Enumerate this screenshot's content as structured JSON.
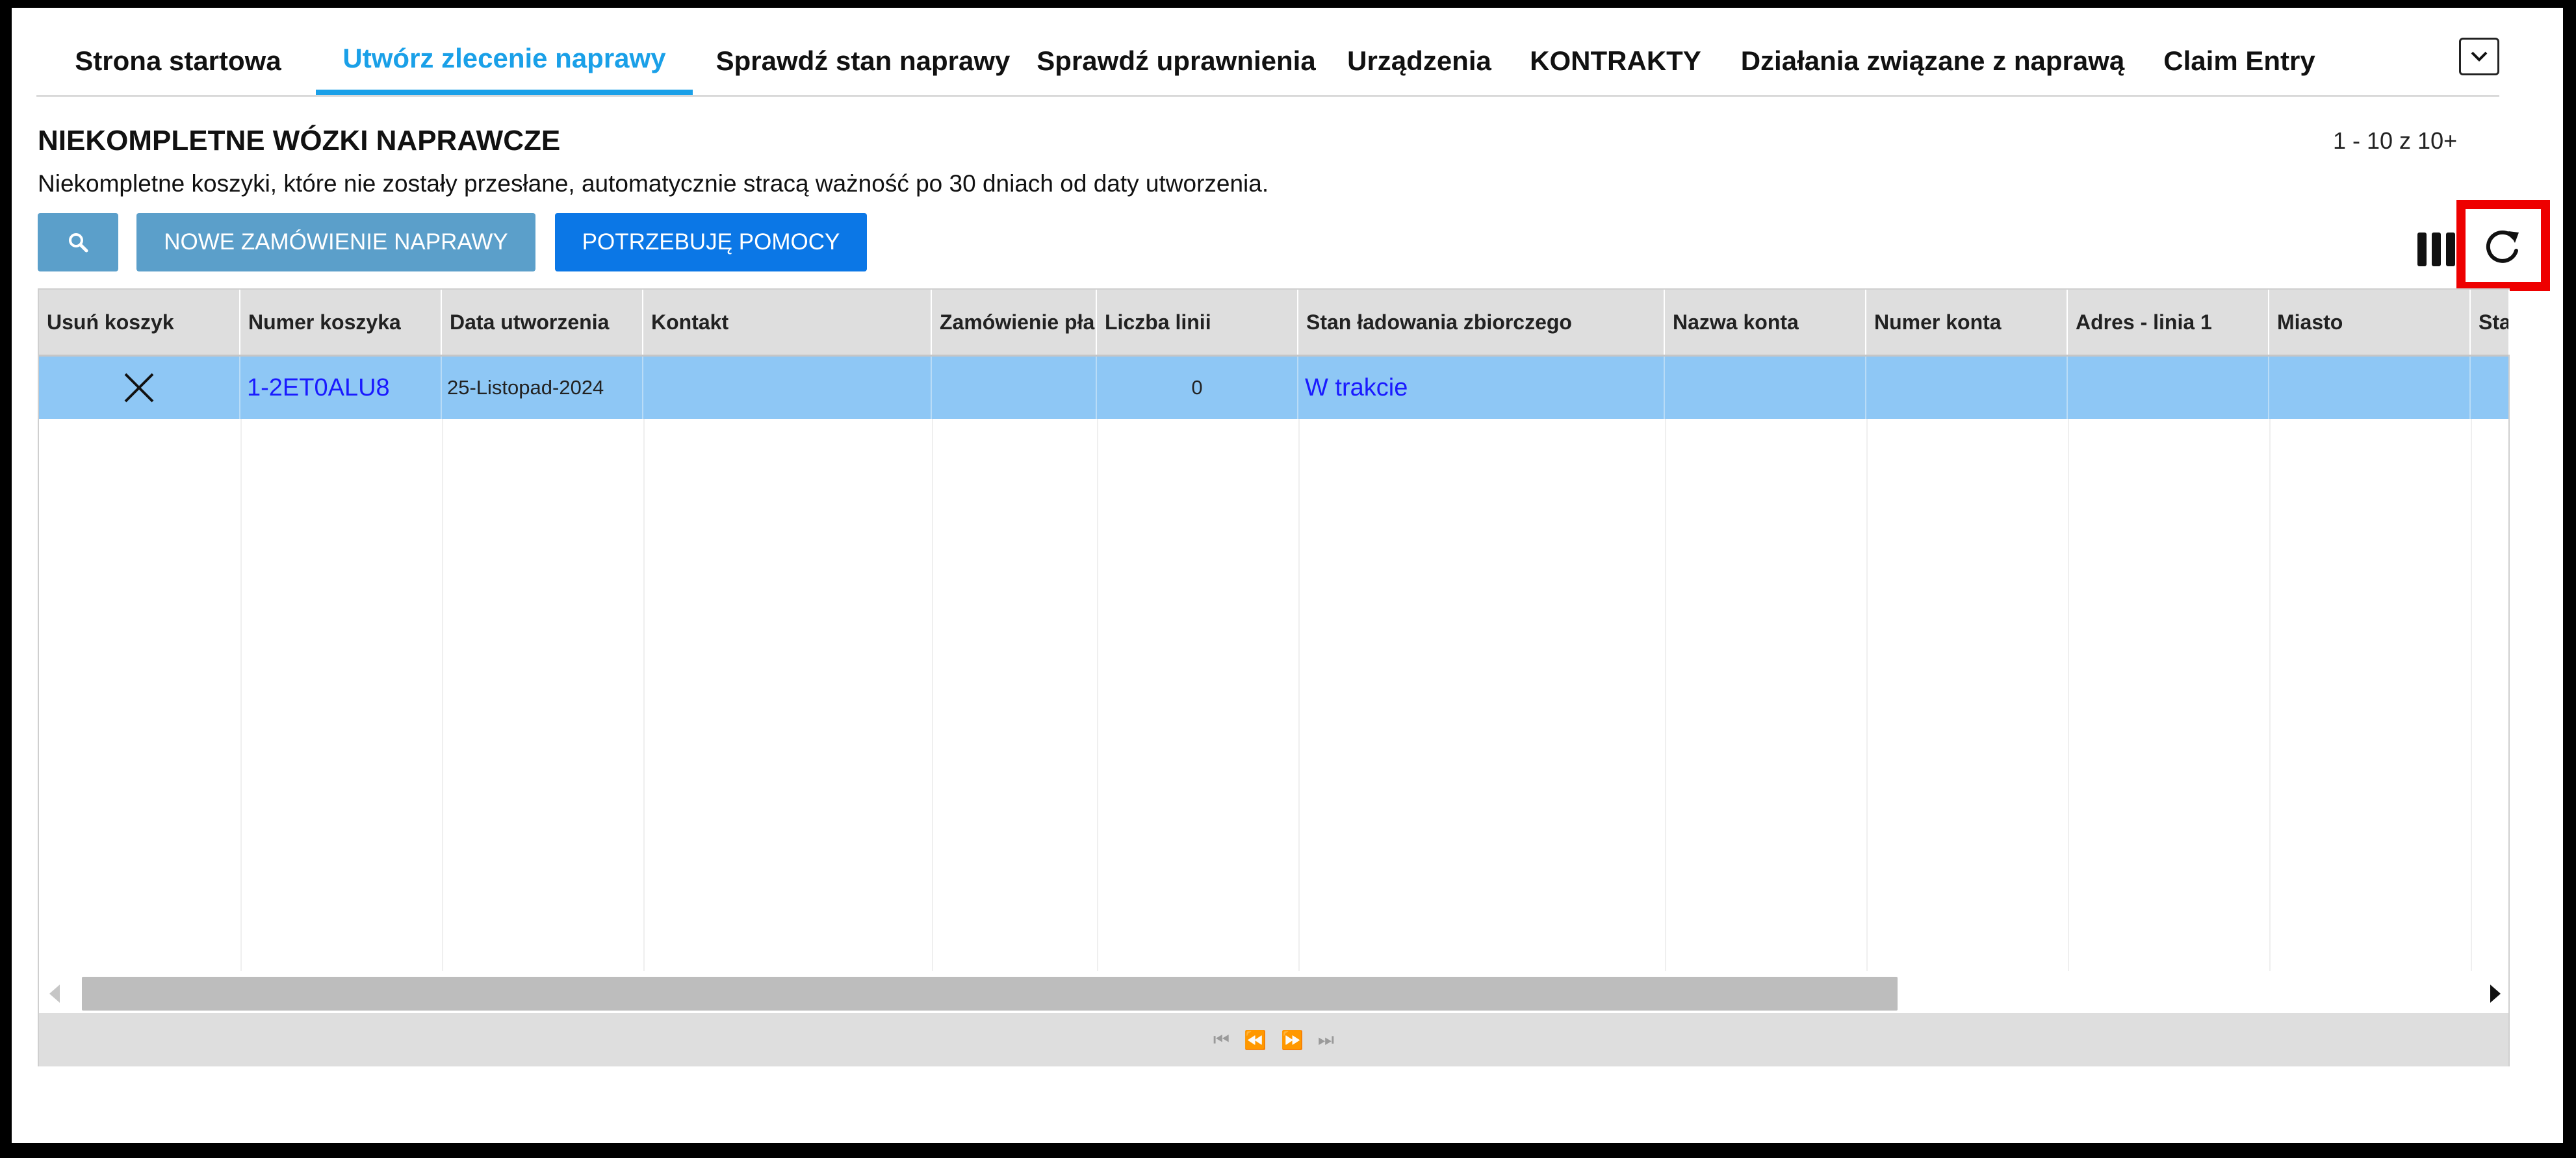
{
  "tabs": {
    "items": [
      {
        "label": "Strona startowa"
      },
      {
        "label": "Utwórz zlecenie naprawy"
      },
      {
        "label": "Sprawdź stan naprawy"
      },
      {
        "label": "Sprawdź uprawnienia"
      },
      {
        "label": "Urządzenia"
      },
      {
        "label": "KONTRAKTY"
      },
      {
        "label": "Działania związane z naprawą"
      },
      {
        "label": "Claim Entry"
      }
    ],
    "active_index": 1
  },
  "page": {
    "title": "NIEKOMPLETNE WÓZKI NAPRAWCZE",
    "subtitle": "Niekompletne koszyki, które nie zostały przesłane, automatycznie stracą ważność po 30 dniach od daty utworzenia.",
    "paging": "1 - 10 z 10+"
  },
  "toolbar": {
    "search_icon": "search-icon",
    "new_order_label": "NOWE ZAMÓWIENIE NAPRAWY",
    "help_label": "POTRZEBUJĘ POMOCY",
    "columns_icon": "columns-icon",
    "refresh_icon": "refresh-icon"
  },
  "grid": {
    "headers": [
      "Usuń koszyk",
      "Numer koszyka",
      "Data utworzenia",
      "Kontakt",
      "Zamówienie pła",
      "Liczba linii",
      "Stan ładowania zbiorczego",
      "Nazwa konta",
      "Numer konta",
      "Adres - linia 1",
      "Miasto",
      "Sta"
    ],
    "rows": [
      {
        "delete_icon": "close-icon",
        "cart_number": "1-2ET0ALU8",
        "created_date": "25-Listopad-2024",
        "contact": "",
        "payment_order": "",
        "line_count": "0",
        "bulk_status": "W trakcie",
        "account_name": "",
        "account_number": "",
        "address_line1": "",
        "city": "",
        "state": ""
      }
    ],
    "selected_row_color": "#8ec7f5"
  },
  "colors": {
    "accent": "#1aa0e8",
    "link": "#1a1aff",
    "button_light": "#5b9fca",
    "button_primary": "#0b77e6",
    "highlight": "#ee0000"
  }
}
